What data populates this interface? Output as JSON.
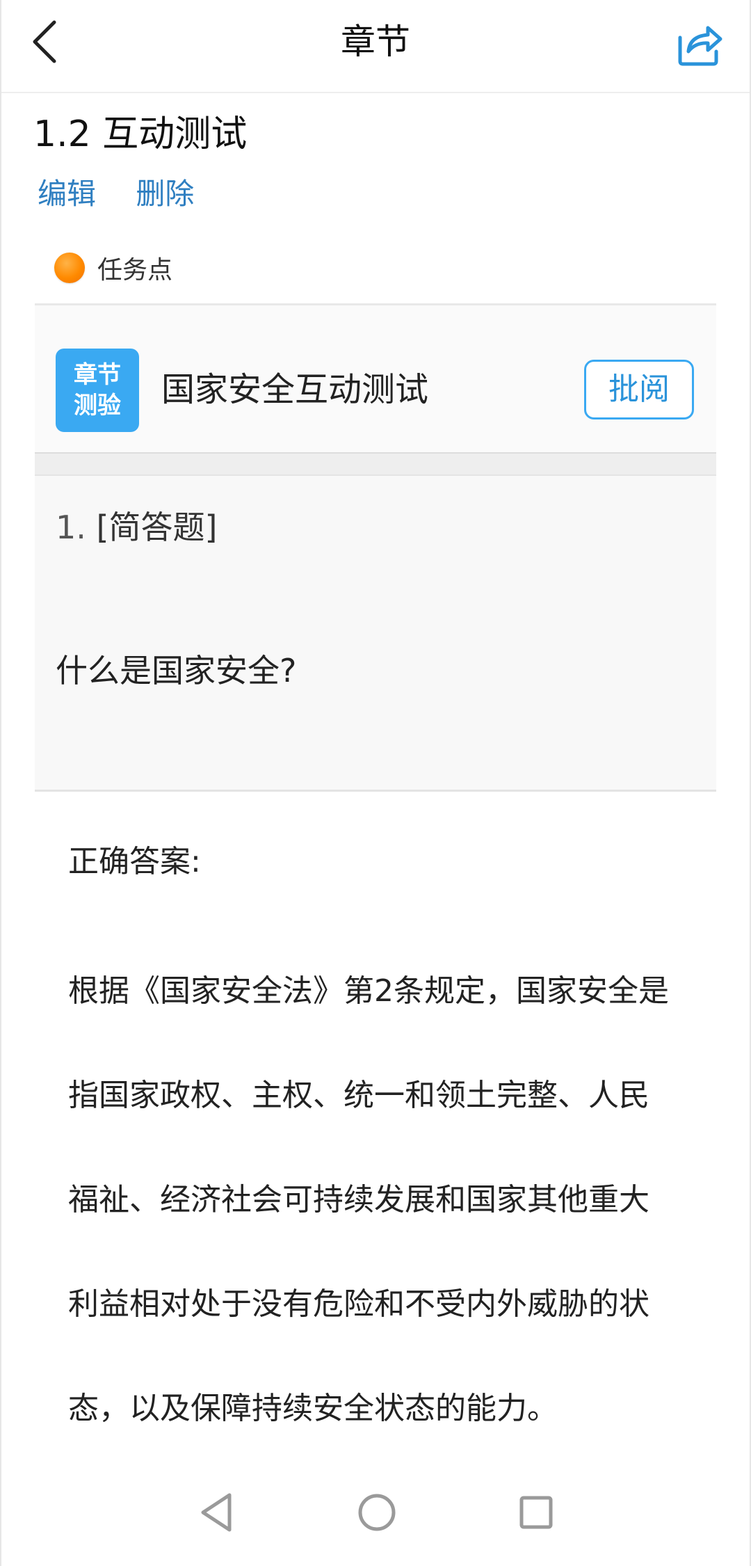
{
  "header": {
    "title": "章节"
  },
  "section": {
    "title": "1.2 互动测试",
    "edit_label": "编辑",
    "delete_label": "删除"
  },
  "task_point": {
    "label": "任务点"
  },
  "quiz_card": {
    "badge_line1": "章节",
    "badge_line2": "测验",
    "title": "国家安全互动测试",
    "review_label": "批阅"
  },
  "question": {
    "number": "1.",
    "type": "[简答题]",
    "text": "什么是国家安全?"
  },
  "answer": {
    "label": "正确答案:",
    "lines": [
      "根据《国家安全法》第2条规定，国家安全是",
      "指国家政权、主权、统一和领土完整、人民",
      "福祉、经济社会可持续发展和国家其他重大",
      "利益相对处于没有危险和不受内外威胁的状",
      "态，以及保障持续安全状态的能力。"
    ]
  },
  "colors": {
    "link": "#2f7fc1",
    "accent": "#3aa9f2",
    "task_dot": "#ff8a00"
  }
}
